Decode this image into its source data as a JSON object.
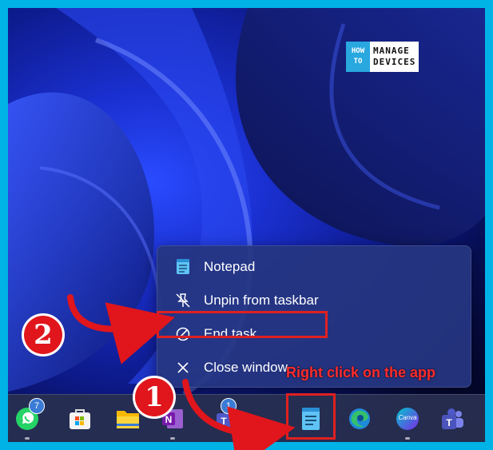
{
  "watermark": {
    "line1": "HOW",
    "line2": "TO",
    "brand_top": "MANAGE",
    "brand_bottom": "DEVICES"
  },
  "context_menu": {
    "items": [
      {
        "label": "Notepad",
        "icon": "notepad-icon"
      },
      {
        "label": "Unpin from taskbar",
        "icon": "unpin-icon"
      },
      {
        "label": "End task",
        "icon": "end-task-icon"
      },
      {
        "label": "Close window",
        "icon": "close-icon"
      }
    ]
  },
  "annotations": {
    "step1": "1",
    "step2": "2",
    "callout": "Right click on the app"
  },
  "taskbar": {
    "apps": [
      {
        "name": "whatsapp",
        "badge": "7"
      },
      {
        "name": "microsoft-store"
      },
      {
        "name": "file-explorer"
      },
      {
        "name": "onenote"
      },
      {
        "name": "teams-classic",
        "badge": "1"
      },
      {
        "name": "notepad"
      },
      {
        "name": "edge"
      },
      {
        "name": "canva"
      },
      {
        "name": "teams"
      }
    ],
    "canva_label": "Canva"
  },
  "colors": {
    "highlight": "#e02020",
    "menu_bg": "#263680",
    "accent": "#29a8e0"
  }
}
